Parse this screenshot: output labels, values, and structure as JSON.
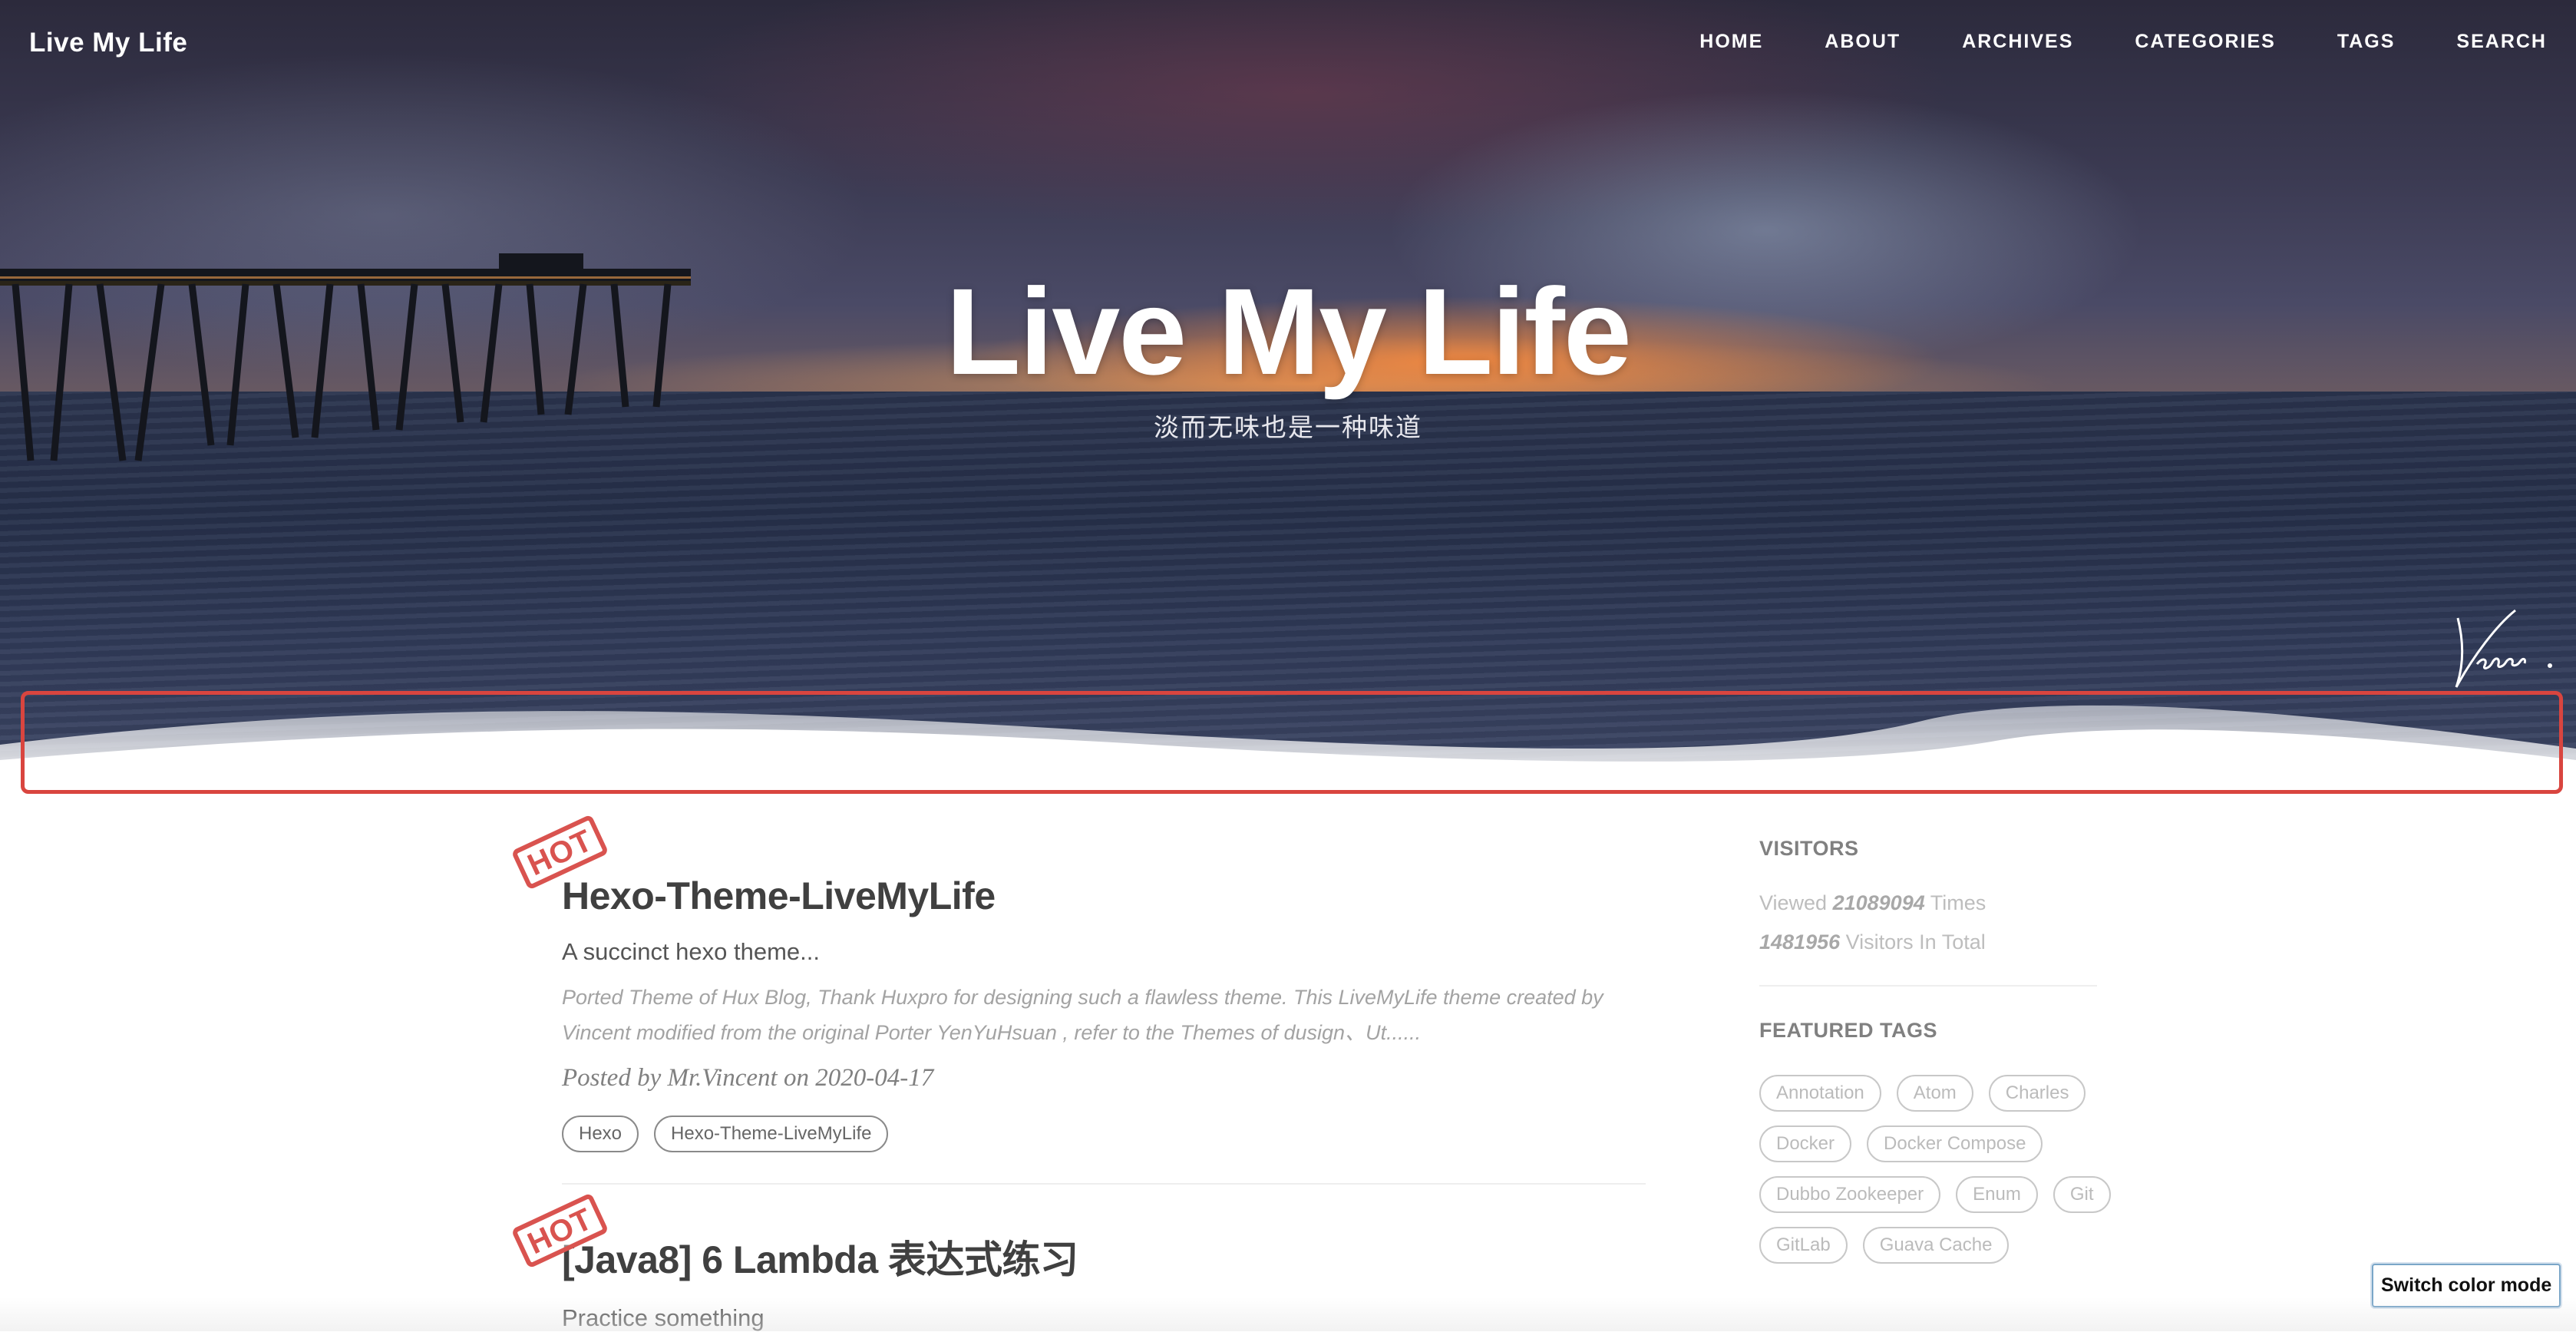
{
  "header": {
    "brand": "Live My Life",
    "nav": [
      {
        "label": "HOME"
      },
      {
        "label": "ABOUT"
      },
      {
        "label": "ARCHIVES"
      },
      {
        "label": "CATEGORIES"
      },
      {
        "label": "TAGS"
      },
      {
        "label": "SEARCH"
      }
    ]
  },
  "hero": {
    "title": "Live My Life",
    "subtitle": "淡而无味也是一种味道"
  },
  "posts": [
    {
      "badge": "HOT",
      "title": "Hexo-Theme-LiveMyLife",
      "subtitle": "A succinct hexo theme...",
      "excerpt": "Ported Theme of Hux Blog, Thank Huxpro for designing such a flawless theme. This LiveMyLife theme created by Vincent modified from the original Porter YenYuHsuan , refer to the Themes of dusign、Ut......",
      "meta": "Posted by Mr.Vincent on 2020-04-17",
      "tags": [
        "Hexo",
        "Hexo-Theme-LiveMyLife"
      ]
    },
    {
      "badge": "HOT",
      "title": "[Java8] 6 Lambda 表达式练习",
      "subtitle": "Practice something"
    }
  ],
  "sidebar": {
    "visitors_heading": "VISITORS",
    "viewed_prefix": "Viewed",
    "viewed_count": "21089094",
    "viewed_suffix": "Times",
    "visitors_count": "1481956",
    "visitors_suffix": "Visitors In Total",
    "featured_heading": "FEATURED TAGS",
    "featured_tags": [
      "Annotation",
      "Atom",
      "Charles",
      "Docker",
      "Docker Compose",
      "Dubbo Zookeeper",
      "Enum",
      "Git",
      "GitLab",
      "Guava Cache"
    ]
  },
  "switch_color_mode": "Switch color mode",
  "colors": {
    "accent_red": "#d9534f",
    "highlight_box": "#d9453f",
    "text_dark": "#404040",
    "text_muted": "#a3a3a3"
  }
}
